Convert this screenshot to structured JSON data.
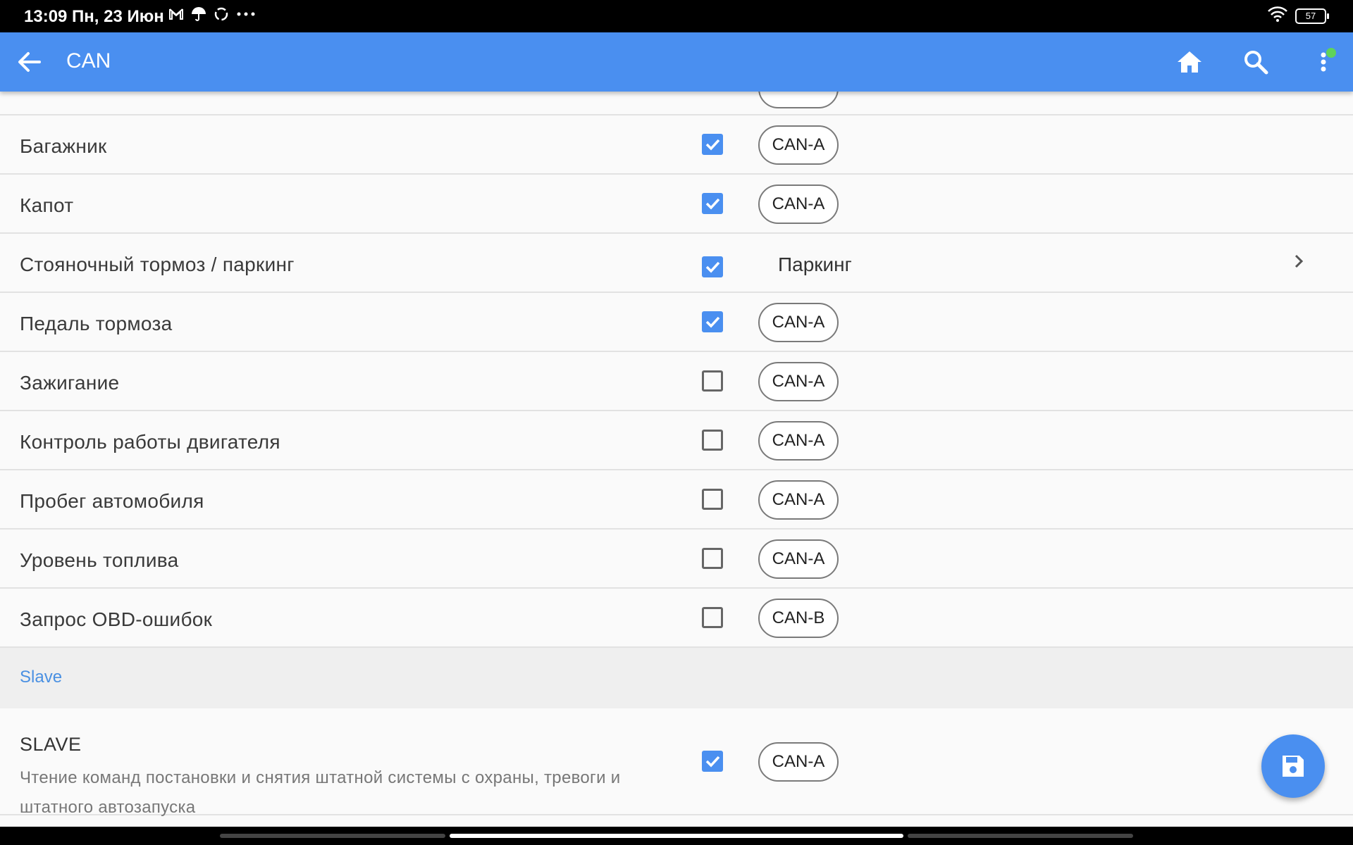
{
  "status_bar": {
    "time": "13:09 Пн, 23 Июн",
    "battery": "57",
    "icons": [
      "gmail-icon",
      "umbrella-icon",
      "sync-icon",
      "more-dots-icon",
      "wifi-icon",
      "battery-icon"
    ]
  },
  "app_bar": {
    "title": "CAN",
    "icons": [
      "back-arrow-icon",
      "home-icon",
      "search-icon",
      "more-vert-icon"
    ]
  },
  "rows": [
    {
      "label": "Багажник",
      "checked": true,
      "chip": "CAN-A"
    },
    {
      "label": "Капот",
      "checked": true,
      "chip": "CAN-A"
    },
    {
      "label": "Стояночный тормоз / паркинг",
      "checked": true,
      "value": "Паркинг"
    },
    {
      "label": "Педаль тормоза",
      "checked": true,
      "chip": "CAN-A"
    },
    {
      "label": "Зажигание",
      "checked": false,
      "chip": "CAN-A"
    },
    {
      "label": "Контроль работы двигателя",
      "checked": false,
      "chip": "CAN-A"
    },
    {
      "label": "Пробег автомобиля",
      "checked": false,
      "chip": "CAN-A"
    },
    {
      "label": "Уровень топлива",
      "checked": false,
      "chip": "CAN-A"
    },
    {
      "label": "Запрос OBD-ошибок",
      "checked": false,
      "chip": "CAN-B"
    }
  ],
  "section": {
    "label": "Slave"
  },
  "slave": {
    "title": "SLAVE",
    "description": "Чтение команд постановки и снятия штатной системы с охраны, тревоги и штатного автозапуска",
    "checked": true,
    "chip": "CAN-A"
  },
  "colors": {
    "accent": "#4a8ff0",
    "section_label": "#4a90e2"
  }
}
